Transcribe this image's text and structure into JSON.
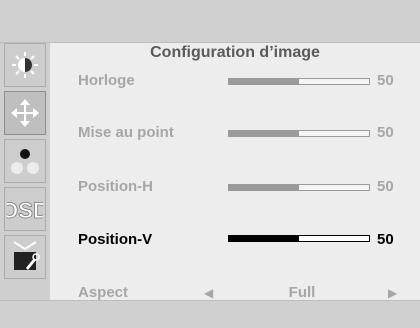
{
  "menu": {
    "title": "Configuration d’image",
    "rows": [
      {
        "label": "Horloge",
        "value": "50",
        "level": 0.5
      },
      {
        "label": "Mise au point",
        "value": "50",
        "level": 0.5
      },
      {
        "label": "Position-H",
        "value": "50",
        "level": 0.5
      },
      {
        "label": "Position-V",
        "value": "50",
        "level": 0.5,
        "selected": true
      }
    ],
    "aspect": {
      "label": "Aspect",
      "value": "Full",
      "left_arrow": "◀",
      "right_arrow": "▶"
    }
  },
  "sidebar": {
    "tabs": [
      {
        "icon": "brightness-icon"
      },
      {
        "icon": "move-arrows-icon",
        "active": true
      },
      {
        "icon": "color-dots-icon"
      },
      {
        "icon": "osd-icon",
        "text": "OSD"
      },
      {
        "icon": "setup-tool-icon"
      }
    ]
  }
}
